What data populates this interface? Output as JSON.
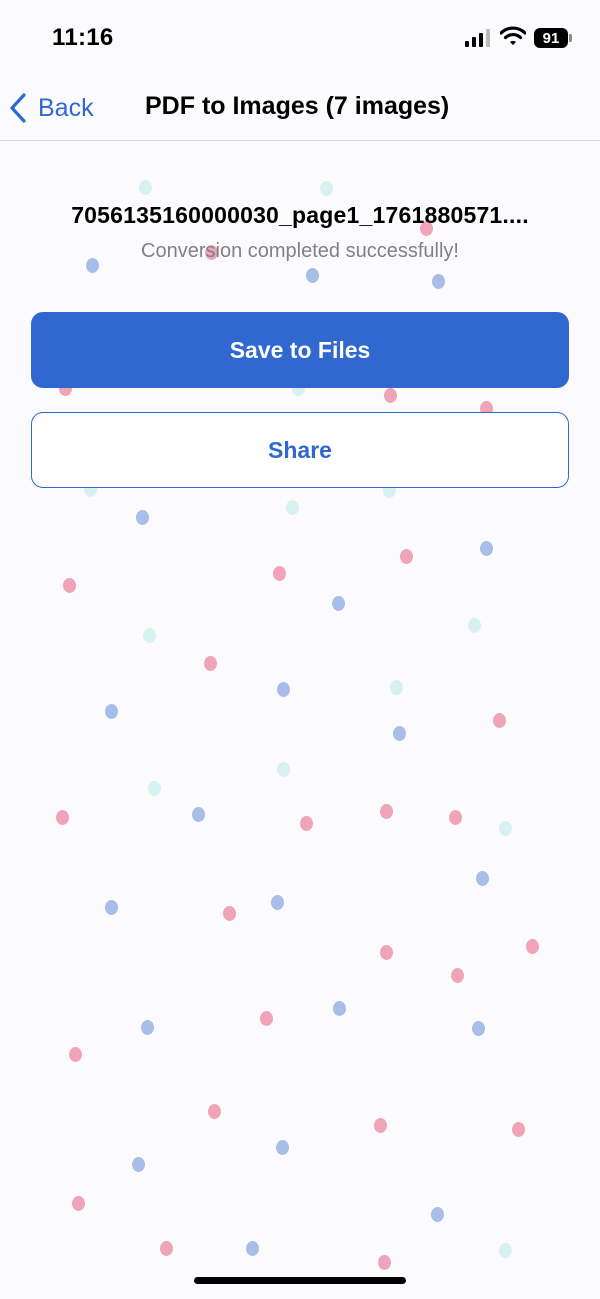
{
  "status_bar": {
    "time": "11:16",
    "battery": "91"
  },
  "nav": {
    "back_label": "Back",
    "title": "PDF to Images (7 images)"
  },
  "content": {
    "filename": "7056135160000030_page1_1761880571....",
    "status_message": "Conversion completed successfully!"
  },
  "actions": {
    "save_label": "Save to Files",
    "share_label": "Share"
  },
  "colors": {
    "accent": "#3168d0",
    "back_link": "#2f68d1",
    "confetti": [
      "#a8bde8",
      "#efa5b7",
      "#d7f1f2"
    ]
  }
}
